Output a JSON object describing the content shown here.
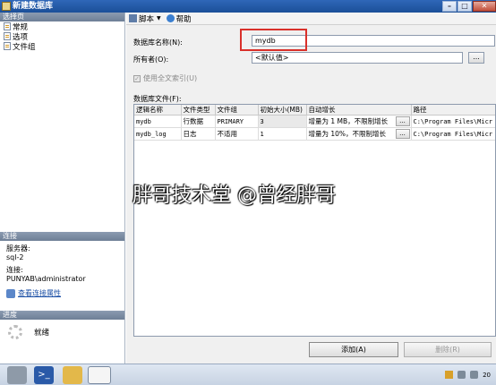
{
  "window": {
    "title": "新建数据库",
    "controls": [
      "minimize",
      "maximize",
      "close"
    ]
  },
  "left_panel": {
    "select_page_header": "选择页",
    "pages": [
      {
        "label": "常规",
        "icon": "page-icon"
      },
      {
        "label": "选项",
        "icon": "page-icon"
      },
      {
        "label": "文件组",
        "icon": "page-icon"
      }
    ],
    "connection_header": "连接",
    "server_label": "服务器:",
    "server_value": "sql-2",
    "connection_label": "连接:",
    "connection_value": "PUNYAB\\administrator",
    "view_connection_link": "查看连接属性",
    "progress_header": "进度",
    "progress_status": "就绪"
  },
  "toolbar": {
    "script_label": "脚本",
    "help_label": "帮助"
  },
  "form": {
    "db_name_label": "数据库名称(N):",
    "db_name_value": "mydb",
    "owner_label": "所有者(O):",
    "owner_value": "<默认值>",
    "fulltext_label": "使用全文索引(U)",
    "fulltext_checked": true,
    "fulltext_enabled": false,
    "db_files_label": "数据库文件(F):",
    "ellipsis": "..."
  },
  "files_table": {
    "columns": [
      "逻辑名称",
      "文件类型",
      "文件组",
      "初始大小(MB)",
      "自动增长",
      "路径"
    ],
    "rows": [
      {
        "logical_name": "mydb",
        "file_type": "行数据",
        "filegroup": "PRIMARY",
        "initial_size": "3",
        "autogrowth": "增量为 1 MB，不限制增长",
        "path": "C:\\Program Files\\Micr"
      },
      {
        "logical_name": "mydb_log",
        "file_type": "日志",
        "filegroup": "不适用",
        "initial_size": "1",
        "autogrowth": "增量为 10%，不限制增长",
        "path": "C:\\Program Files\\Micr"
      }
    ]
  },
  "watermark": "胖哥技术堂 @曾经胖哥",
  "buttons": {
    "add": "添加(A)",
    "remove": "删除(R)"
  },
  "taskbar": {
    "clock_fragment": "20"
  }
}
